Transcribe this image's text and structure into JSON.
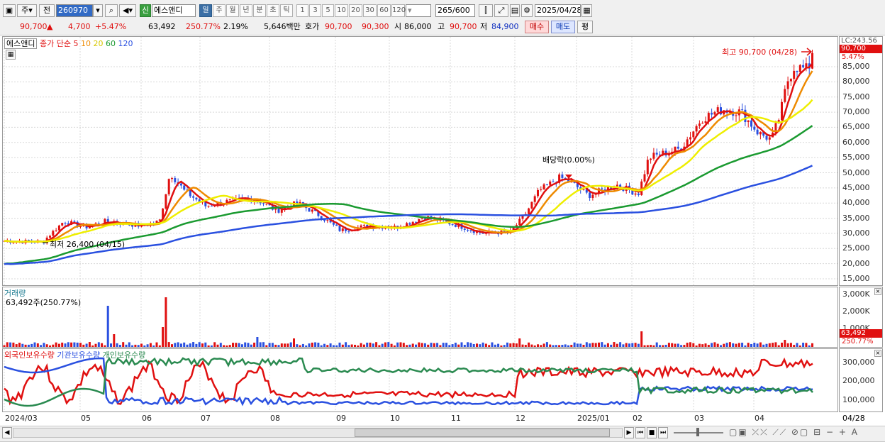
{
  "toolbar": {
    "type_sel": "주",
    "prev_label": "전",
    "code": "260970",
    "badge": "신",
    "name": "에스앤디",
    "periods": [
      "일",
      "주",
      "월",
      "년",
      "분",
      "초",
      "틱"
    ],
    "active_period": "일",
    "nums": [
      "1",
      "3",
      "5",
      "10",
      "20",
      "30",
      "60",
      "120"
    ],
    "count": "265",
    "total": "/600",
    "date": "2025/04/28"
  },
  "quote": {
    "price": "90,700",
    "up_arrow": "▲",
    "change": "4,700",
    "pct": "+5.47%",
    "volume": "63,492",
    "vol_ratio": "250.77%",
    "turnover": "2.19%",
    "amount": "5,646백만",
    "hoga_label": "호가",
    "ask": "90,700",
    "bid": "90,300",
    "open_label": "시",
    "open": "86,000",
    "high_label": "고",
    "high": "90,700",
    "low_label": "저",
    "low": "84,900",
    "buy_label": "매수",
    "sell_label": "매도",
    "eval_label": "평"
  },
  "price_panel": {
    "name": "에스앤디",
    "ma_title": "종가 단순",
    "ma_periods": [
      "5",
      "10",
      "20",
      "60",
      "120"
    ],
    "ma_colors": [
      "#e01010",
      "#ee8a00",
      "#eeee00",
      "#1a9a30",
      "#2a50e0"
    ],
    "lc": "LC:243.56",
    "last_price": "90,700",
    "last_pct": "5.47%",
    "high_note": "최고 90,700 (04/28)",
    "low_note": "최저 26,400 (04/15)",
    "dividend_note": "배당락(0.00%)",
    "yticks": [
      "85,000",
      "80,000",
      "75,000",
      "70,000",
      "65,000",
      "60,000",
      "55,000",
      "50,000",
      "45,000",
      "40,000",
      "35,000",
      "30,000",
      "25,000",
      "20,000",
      "15,000"
    ]
  },
  "volume_panel": {
    "title": "거래량",
    "value": "63,492주(250.77%)",
    "yticks": [
      "3,000K",
      "2,000K",
      "1,000K"
    ],
    "last": "63,492",
    "last_pct": "250.77%"
  },
  "holdings_panel": {
    "series": [
      "외국인보유수량",
      "기관보유수량",
      "개인보유수량"
    ],
    "colors": [
      "#e01010",
      "#2a50e0",
      "#2a8a50"
    ],
    "yticks": [
      "300,000",
      "200,000",
      "100,000"
    ]
  },
  "xaxis": {
    "labels": [
      "2024/03",
      "05",
      "06",
      "07",
      "08",
      "09",
      "10",
      "11",
      "12",
      "2025/01",
      "02",
      "03",
      "04"
    ],
    "right": "04/28"
  }
}
